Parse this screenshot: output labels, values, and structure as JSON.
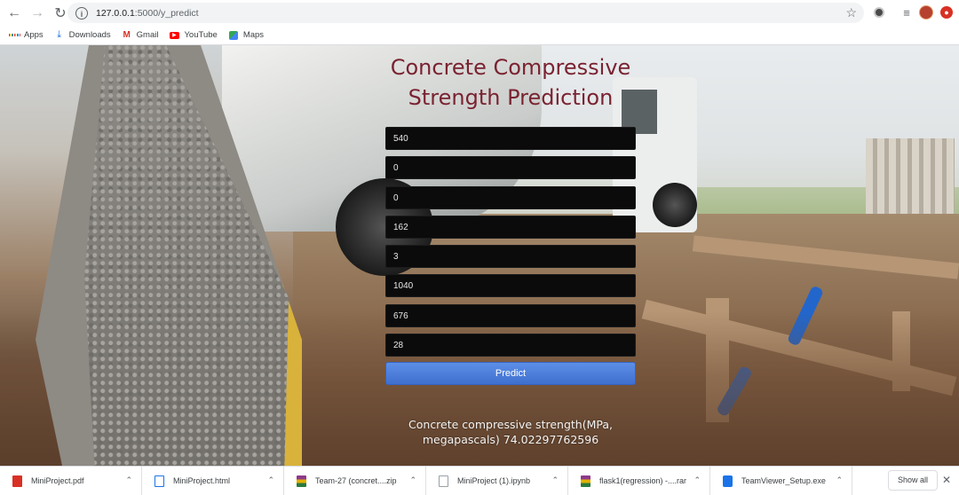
{
  "browser": {
    "url_host": "127.0.0.1",
    "url_path": ":5000/y_predict"
  },
  "bookmarks": [
    {
      "label": "Apps",
      "icon": "apps-grid-icon"
    },
    {
      "label": "Downloads",
      "icon": "download-icon"
    },
    {
      "label": "Gmail",
      "icon": "gmail-icon"
    },
    {
      "label": "YouTube",
      "icon": "youtube-icon"
    },
    {
      "label": "Maps",
      "icon": "maps-icon"
    }
  ],
  "page": {
    "title": "Concrete Compressive Strength Prediction",
    "fields": [
      "540",
      "0",
      "0",
      "162",
      "3",
      "1040",
      "676",
      "28"
    ],
    "predict_label": "Predict",
    "result_text": "Concrete compressive strength(MPa, megapascals) 74.02297762596"
  },
  "downloads": [
    {
      "name": "MiniProject.pdf",
      "icon": "pdf-file-icon",
      "color": "#d93025"
    },
    {
      "name": "MiniProject.html",
      "icon": "html-file-icon",
      "color": "#1a73e8"
    },
    {
      "name": "Team-27 (concret....zip",
      "icon": "archive-file-icon",
      "color": "#8e3a8a"
    },
    {
      "name": "MiniProject (1).ipynb",
      "icon": "document-file-icon",
      "color": "#9aa0a6"
    },
    {
      "name": "flask1(regression) -....rar",
      "icon": "archive-file-icon",
      "color": "#8e3a8a"
    },
    {
      "name": "TeamViewer_Setup.exe",
      "icon": "exe-file-icon",
      "color": "#1a73e8"
    }
  ],
  "shelf": {
    "show_all_label": "Show all"
  },
  "colors": {
    "title": "#7a2331",
    "button": "#4a7bd8",
    "field_bg": "#0b0b0b"
  }
}
